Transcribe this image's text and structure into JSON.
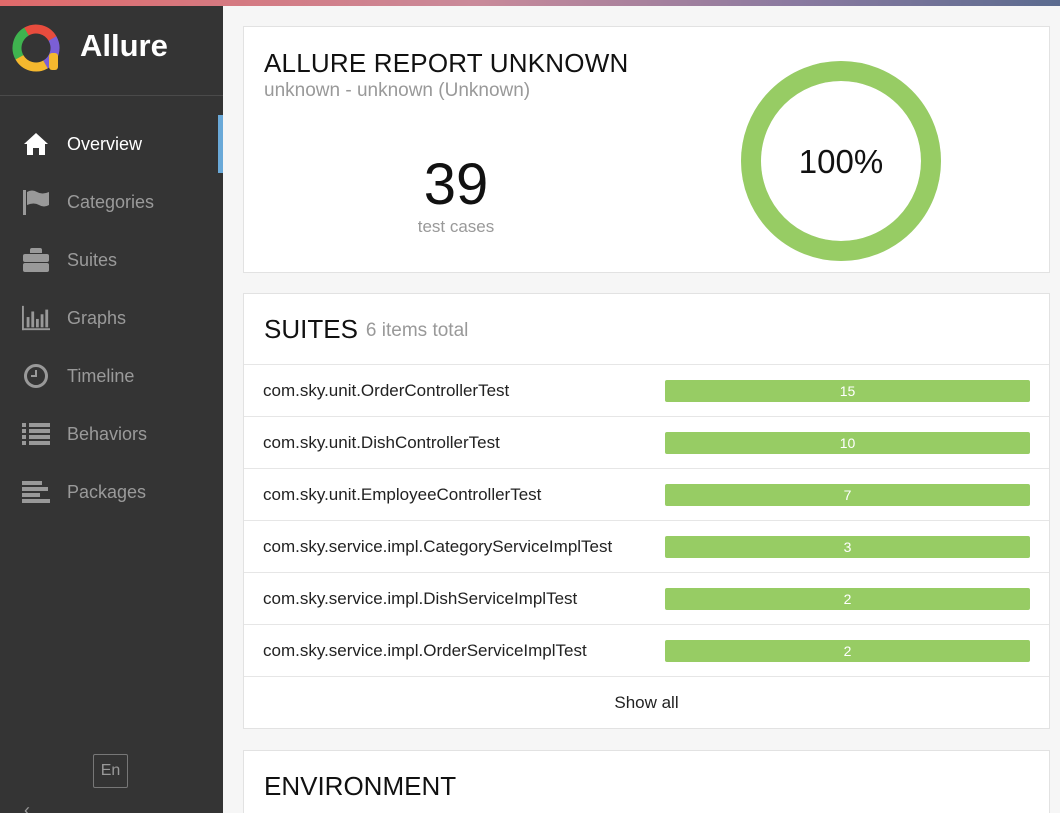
{
  "brand": {
    "name": "Allure"
  },
  "nav": [
    {
      "key": "overview",
      "label": "Overview",
      "icon": "home-icon",
      "active": true
    },
    {
      "key": "categories",
      "label": "Categories",
      "icon": "flag-icon",
      "active": false
    },
    {
      "key": "suites",
      "label": "Suites",
      "icon": "briefcase-icon",
      "active": false
    },
    {
      "key": "graphs",
      "label": "Graphs",
      "icon": "bar-chart-icon",
      "active": false
    },
    {
      "key": "timeline",
      "label": "Timeline",
      "icon": "clock-icon",
      "active": false
    },
    {
      "key": "behaviors",
      "label": "Behaviors",
      "icon": "list-icon",
      "active": false
    },
    {
      "key": "packages",
      "label": "Packages",
      "icon": "align-left-icon",
      "active": false
    }
  ],
  "sidebar_footer": {
    "language": "En",
    "collapse_label": "Collapse"
  },
  "summary": {
    "title": "ALLURE REPORT UNKNOWN",
    "subtitle": "unknown - unknown (Unknown)",
    "test_count": "39",
    "test_count_label": "test cases",
    "pass_rate_text": "100%",
    "pass_rate": 1.0,
    "pass_color": "#97cc64"
  },
  "suites": {
    "title": "SUITES",
    "total_label": "6 items total",
    "items": [
      {
        "name": "com.sky.unit.OrderControllerTest",
        "count": "15"
      },
      {
        "name": "com.sky.unit.DishControllerTest",
        "count": "10"
      },
      {
        "name": "com.sky.unit.EmployeeControllerTest",
        "count": "7"
      },
      {
        "name": "com.sky.service.impl.CategoryServiceImplTest",
        "count": "3"
      },
      {
        "name": "com.sky.service.impl.DishServiceImplTest",
        "count": "2"
      },
      {
        "name": "com.sky.service.impl.OrderServiceImplTest",
        "count": "2"
      }
    ],
    "show_all_label": "Show all"
  },
  "environment": {
    "title": "ENVIRONMENT"
  },
  "colors": {
    "sidebar": "#343434",
    "active_indicator": "#6aa9d8",
    "passed": "#97cc64"
  }
}
